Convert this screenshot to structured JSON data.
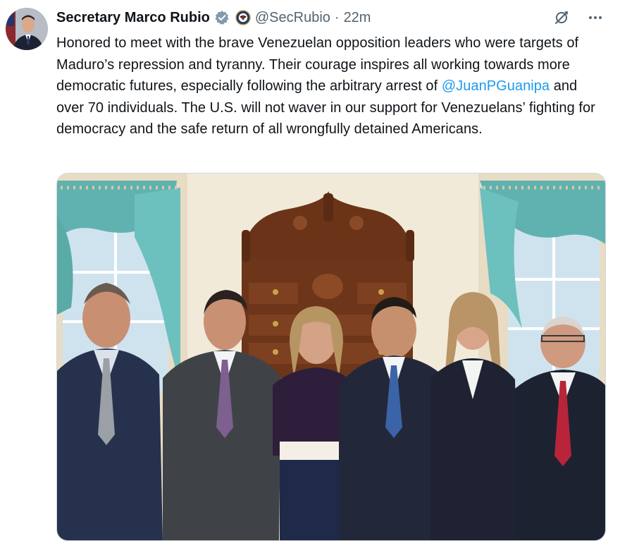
{
  "tweet": {
    "author": {
      "display_name": "Secretary Marco Rubio",
      "handle": "@SecRubio",
      "verified": true,
      "affiliation_icon": "state-department-seal-icon"
    },
    "separator": "·",
    "time_ago": "22m",
    "text": {
      "part1": "Honored to meet with the brave Venezuelan opposition leaders who were targets of Maduro’s repression and tyranny. Their courage inspires all working towards more democratic futures, especially following the arbitrary arrest of ",
      "mention": "@JuanPGuanipa",
      "part2": " and over 70 individuals. The U.S. will not waver in our support for Venezuelans’ fighting for democracy and the safe return of all wrongfully detained Americans."
    },
    "actions": {
      "grok_icon": "grok-icon",
      "more_icon": "more-options-icon"
    }
  },
  "colors": {
    "text": "#0f1419",
    "secondary_text": "#536471",
    "link": "#1d9bf0",
    "verified_badge": "#829aab"
  }
}
